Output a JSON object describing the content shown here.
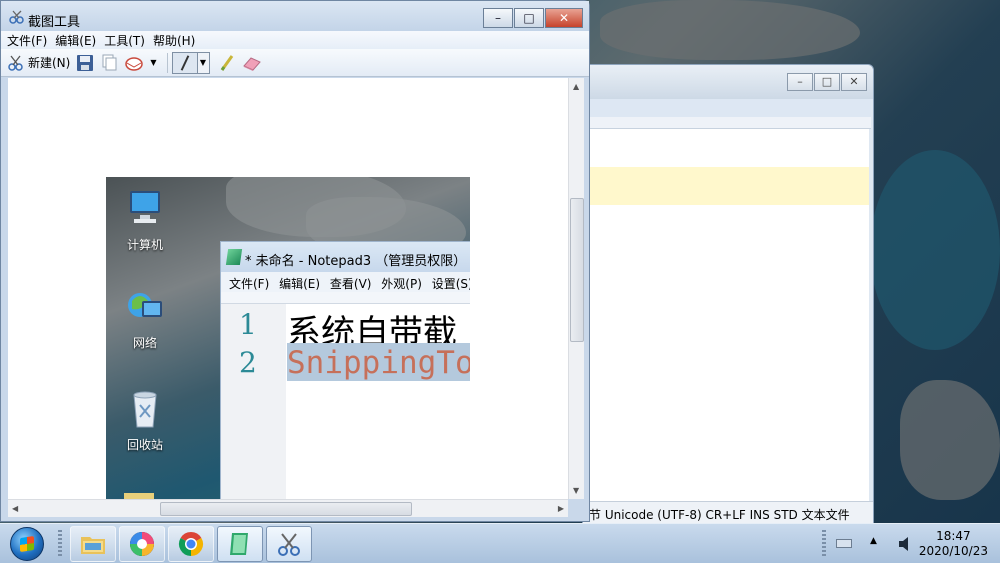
{
  "snipping_tool": {
    "title": "截图工具",
    "menu": [
      "文件(F)",
      "编辑(E)",
      "工具(T)",
      "帮助(H)"
    ],
    "toolbar": {
      "new_label": "新建(N)",
      "icons": [
        "new-snip-icon",
        "save-icon",
        "copy-icon",
        "email-icon",
        "pen-icon",
        "highlighter-icon",
        "eraser-icon"
      ]
    },
    "window_buttons": [
      "minimize",
      "maximize",
      "close"
    ]
  },
  "captured_image": {
    "desktop_icons": [
      "计算机",
      "网络",
      "回收站"
    ],
    "notepad": {
      "title": "* 未命名 - Notepad3 （管理员权限）",
      "menu": [
        "文件(F)",
        "编辑(E)",
        "查看(V)",
        "外观(P)",
        "设置(S)"
      ],
      "line_numbers": [
        "1",
        "2"
      ],
      "line1": "系统自带截",
      "line2": "SnippingTo"
    }
  },
  "background_window": {
    "status": "节 Unicode (UTF-8) CR+LF INS STD 文本文件"
  },
  "taskbar": {
    "apps": [
      "windows-explorer",
      "color-app",
      "chrome",
      "notepad3",
      "snipping-tool"
    ],
    "clock_time": "18:47",
    "clock_date": "2020/10/23"
  },
  "colors": {
    "accent": "#1f6fc1",
    "close_red": "#c6432b"
  }
}
